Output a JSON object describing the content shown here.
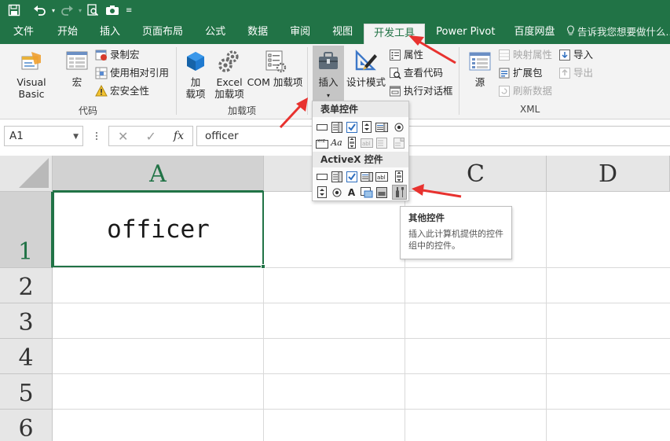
{
  "theme": {
    "accent": "#217346",
    "annotation_arrow": "#e8322f"
  },
  "quick_access": {
    "save_icon": "save-icon",
    "undo_icon": "undo-icon",
    "redo_icon": "redo-icon",
    "preview_icon": "print-preview-icon",
    "camera_icon": "camera-icon",
    "customize_icon": "customize-toolbar-icon"
  },
  "tabs": [
    "文件",
    "开始",
    "插入",
    "页面布局",
    "公式",
    "数据",
    "审阅",
    "视图",
    "开发工具",
    "Power Pivot",
    "百度网盘"
  ],
  "active_tab": "开发工具",
  "tell_me": "告诉我您想要做什么...",
  "ribbon": {
    "code_group": {
      "label": "代码",
      "visual_basic": "Visual Basic",
      "macros": "宏",
      "record_macro": "录制宏",
      "relative_ref": "使用相对引用",
      "macro_security": "宏安全性"
    },
    "addins_group": {
      "label": "加载项",
      "addins_line1": "加",
      "addins_line2": "载项",
      "excel_addins_line1": "Excel",
      "excel_addins_line2": "加载项",
      "com_addins": "COM 加载项"
    },
    "controls_group": {
      "insert": "插入",
      "design_mode": "设计模式",
      "properties": "属性",
      "view_code": "查看代码",
      "run_dialog": "执行对话框"
    },
    "xml_group": {
      "label": "XML",
      "source": "源",
      "map_properties": "映射属性",
      "expansion_packs": "扩展包",
      "refresh_data": "刷新数据",
      "import": "导入",
      "export": "导出"
    }
  },
  "formula_bar": {
    "name_box": "A1",
    "formula": "officer",
    "fx": "fx"
  },
  "grid": {
    "columns": [
      "A",
      "B",
      "C",
      "D"
    ],
    "selected_column": "A",
    "rows": [
      "1",
      "2",
      "3",
      "4",
      "5",
      "6"
    ],
    "cell_A1": "officer"
  },
  "dropdown": {
    "form_controls_header": "表单控件",
    "activex_header": "ActiveX 控件",
    "form_controls": [
      "button-control",
      "combo-box-control",
      "check-box-control",
      "spin-button-control",
      "list-box-control",
      "option-button-control",
      "group-box-control",
      "label-control",
      "scroll-bar-control",
      "text-field-control",
      "combo-list-edit-control",
      "combo-drop-down-edit-control"
    ],
    "activex_controls": [
      "command-button-control",
      "combo-box-control",
      "check-box-control",
      "list-box-control",
      "text-box-control",
      "scroll-bar-control",
      "spin-button-control",
      "option-button-control",
      "label-control",
      "image-control",
      "toggle-button-control",
      "more-controls-control"
    ]
  },
  "tooltip": {
    "title": "其他控件",
    "body": "插入此计算机提供的控件组中的控件。"
  }
}
